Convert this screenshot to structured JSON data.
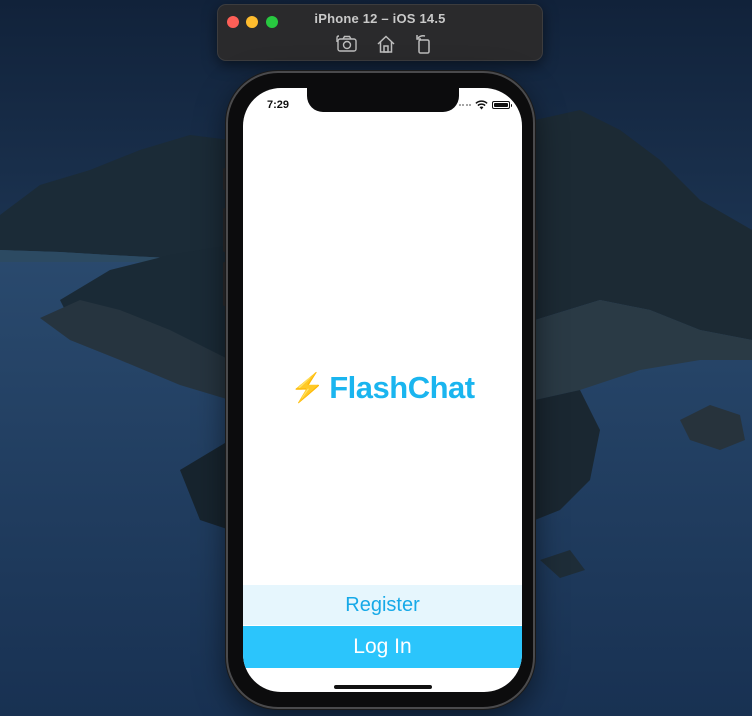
{
  "simulator": {
    "title": "iPhone 12 – iOS 14.5",
    "toolbar": {
      "screenshot_icon": "camera-icon",
      "home_icon": "home-icon",
      "rotate_icon": "rotate-icon"
    }
  },
  "status_bar": {
    "time": "7:29"
  },
  "app": {
    "logo_glyph": "⚡",
    "name": "FlashChat",
    "register_label": "Register",
    "login_label": "Log In"
  },
  "colors": {
    "brand": "#1ab5ef",
    "register_bg": "#e6f6fd",
    "login_bg": "#2bc5fc",
    "bolt": "#f5a20c"
  }
}
